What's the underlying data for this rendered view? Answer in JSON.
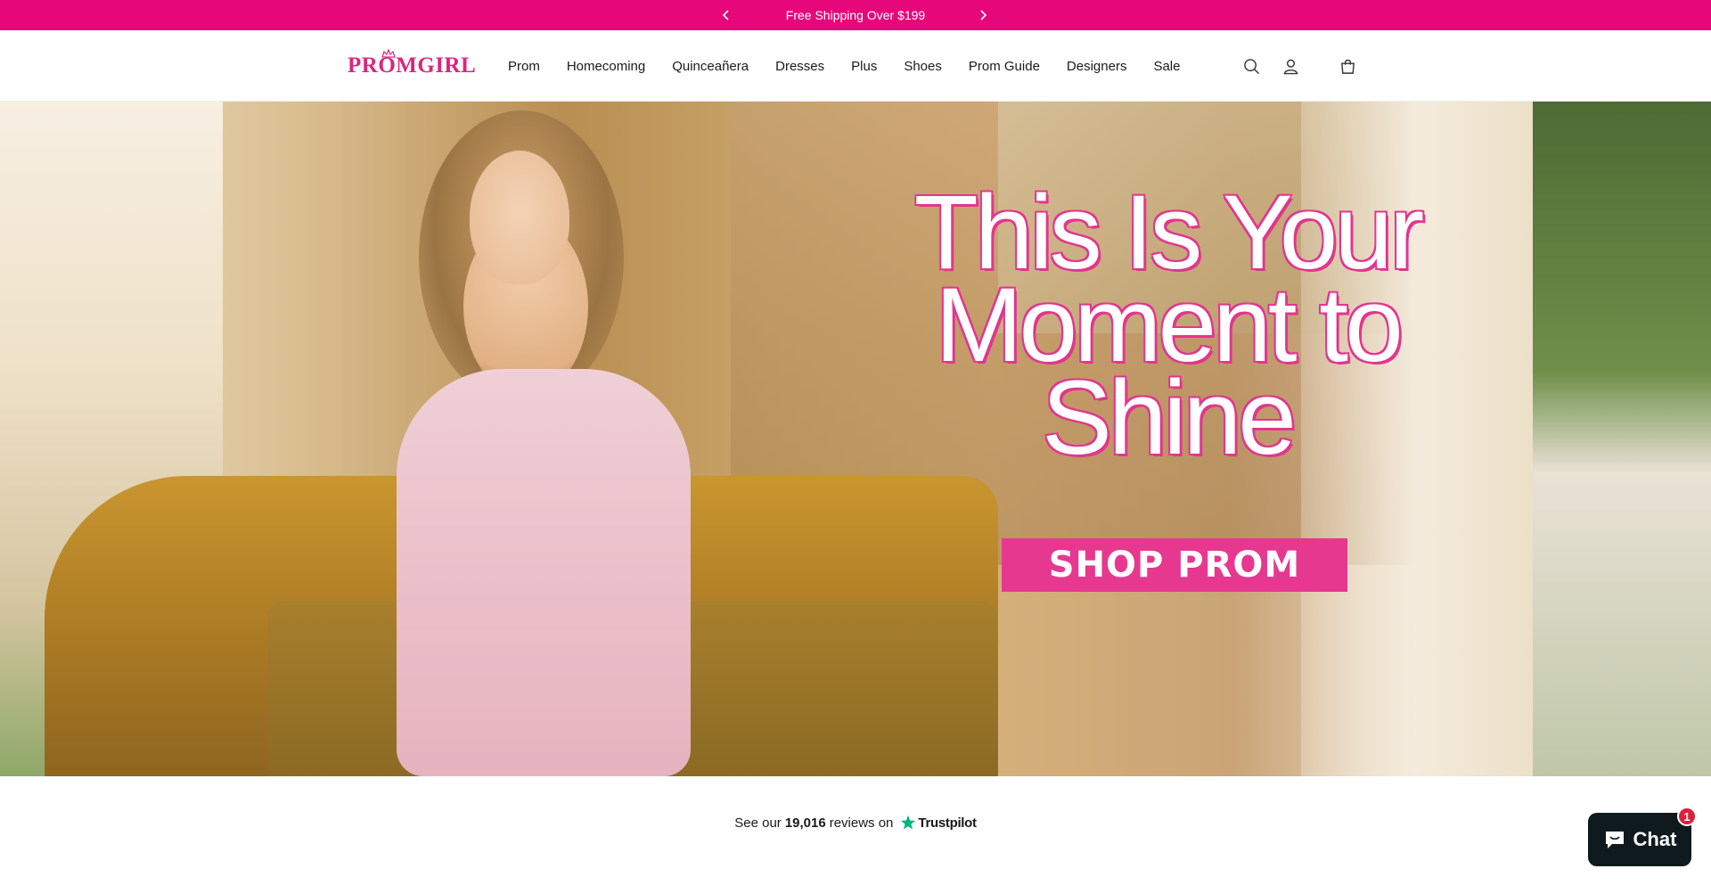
{
  "announcement": {
    "text": "Free Shipping Over $199",
    "prev_icon": "chevron-left-icon",
    "next_icon": "chevron-right-icon",
    "background": "#e6087a"
  },
  "header": {
    "logo_text": "PROMGIRL",
    "nav": [
      {
        "label": "Prom"
      },
      {
        "label": "Homecoming"
      },
      {
        "label": "Quinceañera"
      },
      {
        "label": "Dresses"
      },
      {
        "label": "Plus"
      },
      {
        "label": "Shoes"
      },
      {
        "label": "Prom Guide"
      },
      {
        "label": "Designers"
      },
      {
        "label": "Sale"
      }
    ],
    "icons": [
      "search-icon",
      "account-icon",
      "cart-icon"
    ]
  },
  "hero": {
    "headline_line1": "This Is Your",
    "headline_line2": "Moment to",
    "headline_line3": "Shine",
    "cta_label": "SHOP PROM",
    "accent": "#e6388f"
  },
  "trustpilot": {
    "prefix": "See our",
    "count": "19,016",
    "suffix": "reviews on",
    "brand": "Trustpilot",
    "star_color": "#00b67a"
  },
  "chat": {
    "label": "Chat",
    "badge": "1"
  }
}
